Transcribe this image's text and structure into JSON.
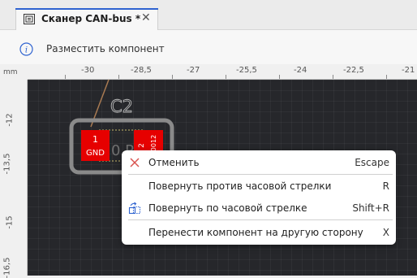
{
  "tab": {
    "title": "Сканер CAN-bus *",
    "close": "✕",
    "icon": "schematic-icon"
  },
  "toolbar": {
    "icon": "info-icon",
    "title": "Разместить компонент"
  },
  "ruler": {
    "unit": "mm",
    "x_ticks": [
      "-30",
      "-28,5",
      "-27",
      "-25,5",
      "-24",
      "-22,5",
      "-21"
    ],
    "y_ticks": [
      "-12",
      "-13,5",
      "-15",
      "-16,5"
    ]
  },
  "component": {
    "designator": "C2",
    "pad1_number": "1",
    "pad1_net": "GND",
    "pad2_number": "2",
    "pad2_net": "N0012",
    "value_fragment": "0.P",
    "colors": {
      "pad": "#e60000",
      "outline": "#8a8a8a",
      "designator": "#b8b8b8"
    }
  },
  "context_menu": {
    "items": [
      {
        "label": "Отменить",
        "shortcut": "Escape",
        "icon": "cancel-icon"
      },
      {
        "label": "Повернуть против часовой стрелки",
        "shortcut": "R",
        "icon": ""
      },
      {
        "label": "Повернуть по часовой стрелке",
        "shortcut": "Shift+R",
        "icon": "rotate-clockwise-icon"
      },
      {
        "label": "Перенести компонент на другую сторону",
        "shortcut": "X",
        "icon": ""
      }
    ]
  },
  "colors": {
    "canvas_bg": "#26272b",
    "accent": "#2f63d0",
    "cancel": "#d9534f"
  }
}
